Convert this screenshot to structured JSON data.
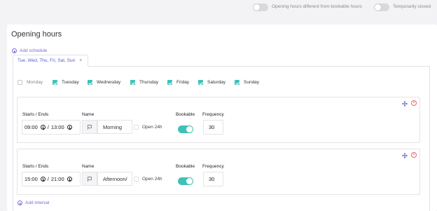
{
  "header": {
    "toggle_diff_label": "Opening hours different from bookable hours",
    "toggle_closed_label": "Temporarily closed"
  },
  "title": "Opening hours",
  "add_schedule_label": "Add schedule",
  "schedule_tab": {
    "label": "Tue, Wed, Thu, Fri, Sat, Sun",
    "close": "×"
  },
  "days": [
    {
      "label": "Monday",
      "checked": false
    },
    {
      "label": "Tuesday",
      "checked": true
    },
    {
      "label": "Wednesday",
      "checked": true
    },
    {
      "label": "Thursday",
      "checked": true
    },
    {
      "label": "Friday",
      "checked": true
    },
    {
      "label": "Saturday",
      "checked": true
    },
    {
      "label": "Sunday",
      "checked": true
    }
  ],
  "field_labels": {
    "starts_ends": "Starts / Ends",
    "name": "Name",
    "bookable": "Bookable",
    "frequency": "Frequency",
    "open_24h": "Open 24h",
    "separator": "/"
  },
  "intervals": [
    {
      "start": "09:00",
      "end": "13:00",
      "name": "Morning",
      "open_24h": false,
      "bookable": true,
      "frequency": "30"
    },
    {
      "start": "15:00",
      "end": "21:00",
      "name": "Afternoon/",
      "open_24h": false,
      "bookable": true,
      "frequency": "30"
    }
  ],
  "add_interval_label": "Add interval",
  "colors": {
    "accent": "#3ec2b8",
    "link": "#7a6bd6",
    "danger": "#e86666"
  }
}
